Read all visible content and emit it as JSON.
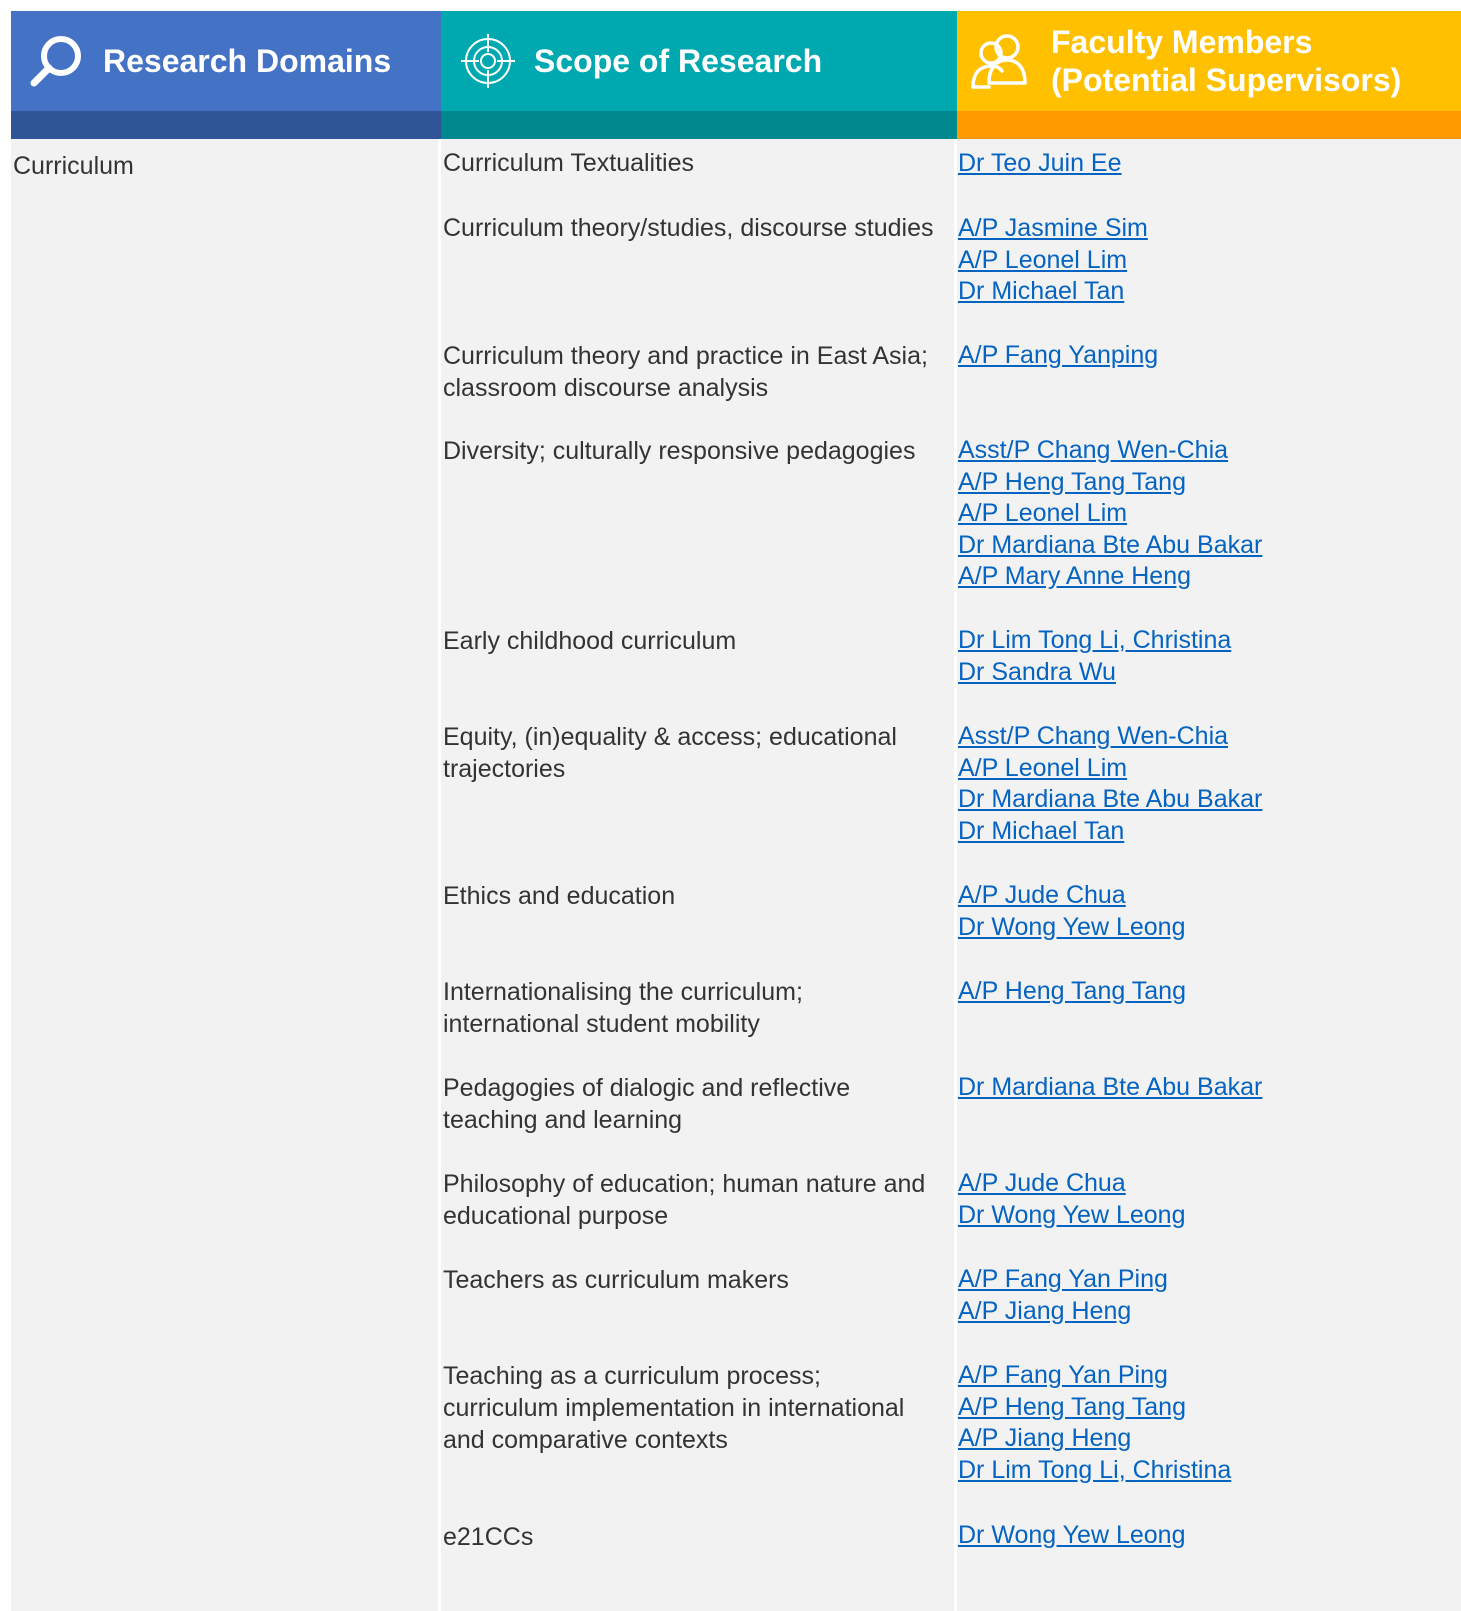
{
  "header": {
    "domains_title": "Research Domains",
    "scope_title": "Scope of Research",
    "faculty_title_line1": "Faculty Members",
    "faculty_title_line2": "(Potential Supervisors)",
    "colors": {
      "domains": "#4472C4",
      "scope": "#00A9B0",
      "faculty": "#FFC000",
      "link": "#0563C1",
      "cell_background": "#F2F2F2"
    },
    "icons": [
      "search-icon",
      "target-icon",
      "people-icon"
    ]
  },
  "domain": "Curriculum",
  "rows": [
    {
      "scope": "Curriculum Textualities",
      "faculty": [
        "Dr Teo Juin Ee"
      ]
    },
    {
      "scope": "Curriculum theory/studies, discourse studies",
      "faculty": [
        "A/P Jasmine Sim",
        "A/P Leonel Lim",
        "Dr Michael Tan"
      ]
    },
    {
      "scope": "Curriculum theory and practice in East Asia; classroom discourse analysis",
      "faculty": [
        "A/P Fang Yanping"
      ]
    },
    {
      "scope": "Diversity; culturally responsive pedagogies",
      "faculty": [
        "Asst/P Chang Wen-Chia",
        "A/P Heng Tang Tang",
        "A/P Leonel Lim",
        "Dr Mardiana Bte Abu Bakar",
        "A/P Mary Anne Heng"
      ]
    },
    {
      "scope": "Early childhood curriculum",
      "faculty": [
        "Dr Lim Tong Li, Christina",
        "Dr Sandra Wu"
      ]
    },
    {
      "scope": "Equity, (in)equality & access; educational trajectories",
      "faculty": [
        "Asst/P Chang Wen-Chia",
        "A/P Leonel Lim",
        "Dr Mardiana Bte Abu Bakar",
        "Dr Michael Tan"
      ]
    },
    {
      "scope": "Ethics and education",
      "faculty": [
        "A/P Jude Chua",
        "Dr Wong Yew Leong"
      ]
    },
    {
      "scope": "Internationalising the curriculum; international student mobility",
      "faculty": [
        "A/P Heng Tang Tang"
      ]
    },
    {
      "scope": "Pedagogies of dialogic and reflective teaching and learning",
      "faculty": [
        "Dr Mardiana Bte Abu Bakar"
      ]
    },
    {
      "scope": "Philosophy of education; human nature and educational purpose",
      "faculty": [
        "A/P Jude Chua",
        "Dr Wong Yew Leong"
      ]
    },
    {
      "scope": "Teachers as curriculum makers",
      "faculty": [
        "A/P Fang Yan Ping",
        "A/P Jiang Heng"
      ]
    },
    {
      "scope": "Teaching as a curriculum process; curriculum implementation in international and comparative contexts",
      "faculty": [
        "A/P Fang Yan Ping",
        "A/P Heng Tang Tang",
        "A/P Jiang Heng",
        "Dr Lim Tong Li, Christina"
      ]
    },
    {
      "scope": "e21CCs",
      "faculty": [
        "Dr Wong Yew Leong"
      ]
    }
  ]
}
